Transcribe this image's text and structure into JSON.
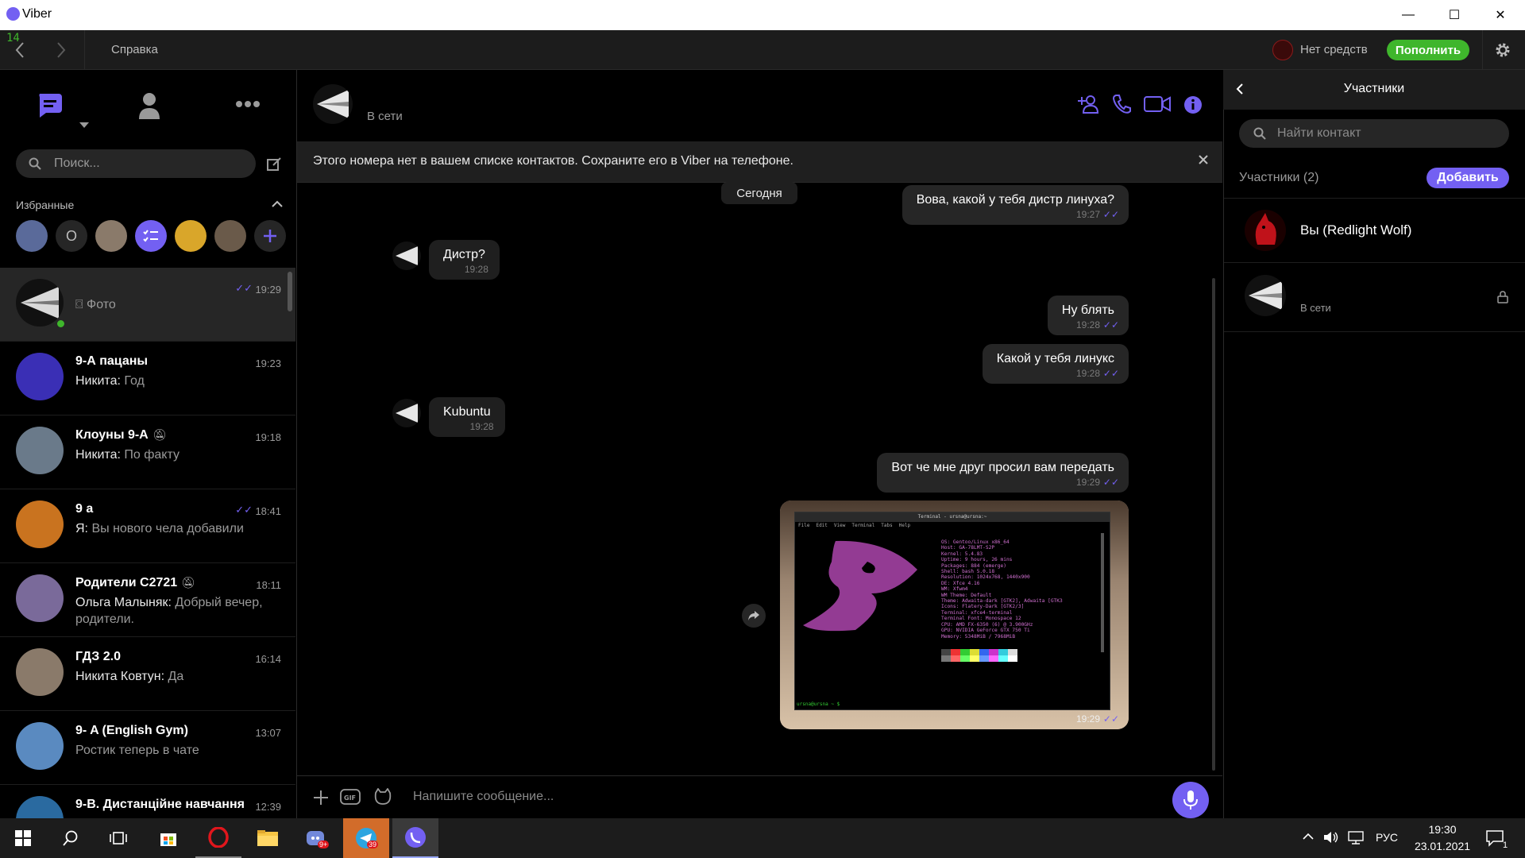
{
  "window": {
    "title": "Viber",
    "minimize": "—",
    "maximize": "☐",
    "close": "✕"
  },
  "nav": {
    "back_num": "14",
    "help": "Справка",
    "funds": "Нет средств",
    "topup": "Пополнить"
  },
  "sidebar": {
    "search_placeholder": "Поиск...",
    "favorites_title": "Избранные",
    "favorites": [
      {
        "label": ""
      },
      {
        "label": "О"
      },
      {
        "label": ""
      },
      {
        "label": ""
      },
      {
        "label": ""
      },
      {
        "label": ""
      }
    ],
    "chats": [
      {
        "name": "",
        "sender": "",
        "text": "Фото",
        "time": "19:29",
        "read": true,
        "active": true,
        "online": true,
        "color": "#d9d9d9"
      },
      {
        "name": "9-А пацаны",
        "sender": "Никита:",
        "text": "Год",
        "time": "19:23",
        "color": "#3a2fb5"
      },
      {
        "name": "Клоуны 9-А",
        "sender": "Никита:",
        "text": "По факту",
        "time": "19:18",
        "muted": true,
        "color": "#6a7a8a"
      },
      {
        "name": "9 а",
        "sender": "Я:",
        "text": "Вы нового чела добавили",
        "time": "18:41",
        "read": true,
        "color": "#c9731f"
      },
      {
        "name": "Родители С2721",
        "sender": "Ольга Малыняк:",
        "text": "Добрый вечер, родители.",
        "time": "18:11",
        "muted": true,
        "color": "#7a6a9a"
      },
      {
        "name": "ГДЗ 2.0",
        "sender": "Никита Ковтун:",
        "text": "Да",
        "time": "16:14",
        "color": "#8a7a6a"
      },
      {
        "name": "9- A (English Gym)",
        "sender": "",
        "text": "Ростик теперь в чате",
        "time": "13:07",
        "color": "#5a8ac0"
      },
      {
        "name": "9-В. Дистанційне навчання",
        "sender": "",
        "text": "",
        "time": "12:39",
        "color": "#2a6aa0"
      }
    ]
  },
  "chat": {
    "status": "В сети",
    "notice": "Этого номера нет в вашем списке контактов. Сохраните его в Viber на телефоне.",
    "day_label": "Сегодня",
    "composer_placeholder": "Напишите сообщение...",
    "messages": [
      {
        "dir": "out",
        "text": "Вова, какой у тебя дистр линуха?",
        "time": "19:27"
      },
      {
        "dir": "in",
        "text": "Дистр?",
        "time": "19:28"
      },
      {
        "dir": "out",
        "text": "Ну блять",
        "time": "19:28"
      },
      {
        "dir": "out",
        "text": "Какой у тебя линукс",
        "time": "19:28"
      },
      {
        "dir": "in",
        "text": "Kubuntu",
        "time": "19:28"
      },
      {
        "dir": "out",
        "text": "Вот че мне друг просил вам передать",
        "time": "19:29"
      },
      {
        "dir": "out",
        "type": "image",
        "time": "19:29"
      }
    ],
    "screenshot": {
      "window_title": "Terminal - ursna@ursna:~",
      "menu": [
        "File",
        "Edit",
        "View",
        "Terminal",
        "Tabs",
        "Help"
      ],
      "info": [
        "OS: Gentoo/Linux x86_64",
        "Host: GA-78LMT-S2P",
        "Kernel: 5.4.83",
        "Uptime: 9 hours, 26 mins",
        "Packages: 884 (emerge)",
        "Shell: bash 5.0.18",
        "Resolution: 1024x768, 1440x900",
        "DE: Xfce 4.16",
        "WM: Xfwm4",
        "WM Theme: Default",
        "Theme: Adwaita-dark [GTK2], Adwaita [GTK3",
        "Icons: Flatery-Dark [GTK2/3]",
        "Terminal: xfce4-terminal",
        "Terminal Font: Monospace 12",
        "CPU: AMD FX-6350 (6) @ 3.900GHz",
        "GPU: NVIDIA GeForce GTX 750 Ti",
        "Memory: 5348MiB / 7968MiB"
      ],
      "prompt": "ursna@ursna ~ $"
    }
  },
  "participants": {
    "title": "Участники",
    "search_placeholder": "Найти контакт",
    "count_label": "Участники (2)",
    "add_button": "Добавить",
    "items": [
      {
        "name": "Вы (Redlight Wolf)",
        "status": ""
      },
      {
        "name": "",
        "status": "В сети"
      }
    ]
  },
  "taskbar": {
    "lang": "РУС",
    "time": "19:30",
    "date": "23.01.2021",
    "discord_badge": "9+",
    "telegram_badge": "39",
    "notif_count": "1"
  },
  "colors": {
    "accent": "#7360f2",
    "green": "#3fb62c",
    "online": "#3fb62c"
  }
}
